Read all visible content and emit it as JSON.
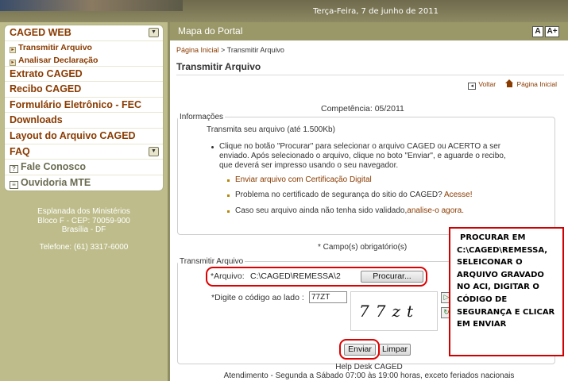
{
  "header": {
    "date": "Terça-Feira, 7 de junho de 2011"
  },
  "sidebar": {
    "items": [
      {
        "label": "CAGED WEB"
      },
      {
        "label": "Transmitir Arquivo"
      },
      {
        "label": "Analisar Declaração"
      },
      {
        "label": "Extrato CAGED"
      },
      {
        "label": "Recibo CAGED"
      },
      {
        "label": "Formulário Eletrônico - FEC"
      },
      {
        "label": "Downloads"
      },
      {
        "label": "Layout do Arquivo CAGED"
      },
      {
        "label": "FAQ"
      },
      {
        "label": "Fale Conosco"
      },
      {
        "label": "Ouvidoria MTE"
      }
    ],
    "address": [
      "Esplanada dos Ministérios",
      "Bloco F - CEP: 70059-900",
      "Brasília - DF"
    ],
    "phone": "Telefone: (61) 3317-6000"
  },
  "main": {
    "header_title": "Mapa do Portal",
    "font_small": "A",
    "font_large": "A+",
    "breadcrumb_home": "Página Inicial",
    "breadcrumb_sep": " > ",
    "breadcrumb_current": "Transmitir Arquivo",
    "page_title": "Transmitir Arquivo",
    "back_label": "Voltar",
    "home_label": "Página Inicial",
    "competencia": "Competência: 05/2011",
    "info": {
      "legend": "Informações",
      "intro": "Transmita seu arquivo (até 1.500Kb)",
      "line1": "Clique no botão \"Procurar\" para selecionar o arquivo CAGED ou ACERTO a ser",
      "line2": "enviado. Após selecionado o arquivo, clique no boto \"Enviar\", e aguarde o recibo,",
      "line3": "que deverá ser impresso usando o seu navegador.",
      "link_cert": "Enviar arquivo com Certificação Digital",
      "problem_text": "Problema no certificado de segurança do sitio do CAGED? ",
      "problem_link": "Acesse!",
      "invalid_text": "Caso seu arquivo ainda não tenha sido validado,",
      "invalid_link": "analise-o agora."
    },
    "required_note": "* Campo(s) obrigatório(s)",
    "form": {
      "legend": "Transmitir Arquivo",
      "file_label": "*Arquivo:",
      "file_value": "C:\\CAGED\\REMESSA\\2",
      "browse_label": "Procurar...",
      "code_label": "*Digite o código ao lado :",
      "code_value": "77ZT",
      "captcha_text": "77zt",
      "send_label": "Enviar",
      "clear_label": "Limpar"
    },
    "help_title": "Help Desk CAGED",
    "help_hours": "Atendimento - Segunda a Sábado 07:00 às 19:00 horas, exceto feriados nacionais"
  },
  "annotation": {
    "lines": [
      "PROCURAR EM",
      "C:\\CAGED\\REMESSA,",
      "SELEICONAR O",
      "ARQUIVO GRAVADO",
      "NO ACI, DIGITAR O",
      "CÓDIGO DE",
      "SEGURANÇA E CLICAR",
      "EM ENVIAR"
    ]
  },
  "colors": {
    "accent": "#8a3b00",
    "sidebar_bg": "#bdbc8a",
    "header_bg": "#9a9868",
    "highlight": "#e00000"
  },
  "icons": [
    "chevron-down-icon",
    "bullet-icon",
    "question-icon",
    "chat-icon",
    "back-icon",
    "home-icon",
    "refresh-icon",
    "audio-icon"
  ]
}
